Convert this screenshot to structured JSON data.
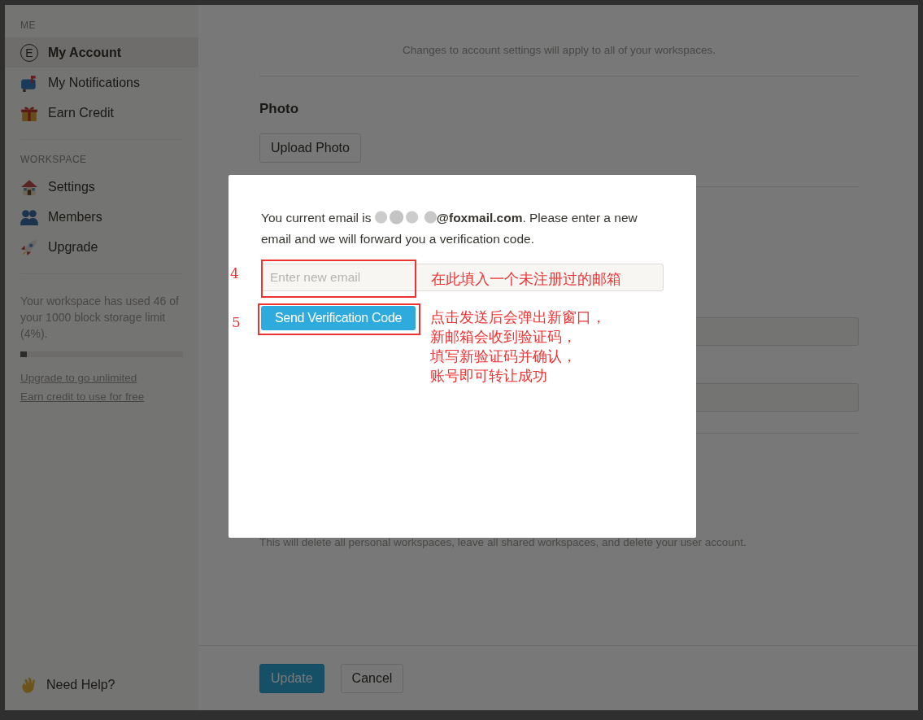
{
  "sidebar": {
    "sections": [
      {
        "heading": "ME",
        "items": [
          {
            "kind": "initial",
            "initial": "E",
            "label": "My Account",
            "selected": true
          },
          {
            "kind": "mailbox",
            "label": "My Notifications",
            "selected": false
          },
          {
            "kind": "gift",
            "label": "Earn Credit",
            "selected": false
          }
        ]
      },
      {
        "heading": "WORKSPACE",
        "items": [
          {
            "kind": "house",
            "label": "Settings",
            "selected": false
          },
          {
            "kind": "people",
            "label": "Members",
            "selected": false
          },
          {
            "kind": "rocket",
            "label": "Upgrade",
            "selected": false
          }
        ]
      }
    ],
    "storage": {
      "text": "Your workspace has used 46 of your 1000 block storage limit (4%).",
      "level": 0.04
    },
    "links": [
      "Upgrade to go unlimited",
      "Earn credit to use for free"
    ],
    "help": "Need Help?"
  },
  "page": {
    "notice": "Changes to account settings will apply to all of your workspaces.",
    "photo": {
      "heading": "Photo",
      "button": "Upload Photo"
    },
    "delete_note": "This will delete all personal workspaces, leave all shared workspaces, and delete your user account.",
    "buttons": [
      "Update",
      "Cancel"
    ]
  },
  "modal": {
    "message_start": "You current email is ",
    "message_rest": "**@foxmail.com**. Please enter a new email and we will forward you a verification code.",
    "email_field": {
      "placeholder": "Enter new email"
    },
    "send_button": "Send Verification Code"
  },
  "annotations": [
    {
      "number": "4",
      "note": "在此填入一个未注册过的邮箱"
    },
    {
      "number": "5",
      "note_lines": [
        "点击发送后会弹出新窗口，",
        "新邮箱会收到验证码，",
        "填写新验证码并确认，",
        "账号即可转让成功"
      ]
    }
  ]
}
